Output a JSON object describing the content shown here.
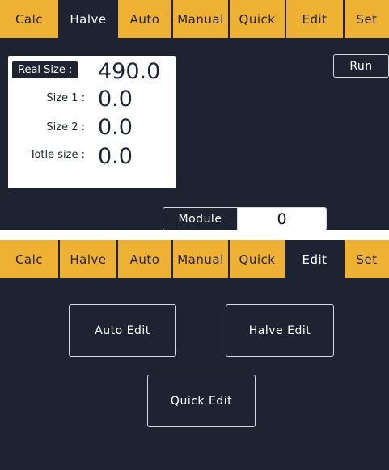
{
  "screen1": {
    "tabs": [
      "Calc",
      "Halve",
      "Auto",
      "Manual",
      "Quick",
      "Edit",
      "Set"
    ],
    "active_tab": "Halve",
    "fields": [
      {
        "label": "Real Size :",
        "value": "490.0"
      },
      {
        "label": "Size 1 :",
        "value": "0.0"
      },
      {
        "label": "Size 2 :",
        "value": "0.0"
      },
      {
        "label": "Totle size :",
        "value": "0.0"
      }
    ],
    "run_label": "Run",
    "module_label": "Module",
    "module_value": "0"
  },
  "screen2": {
    "tabs": [
      "Calc",
      "Halve",
      "Auto",
      "Manual",
      "Quick",
      "Edit",
      "Set"
    ],
    "active_tab": "Edit",
    "auto_edit_label": "Auto Edit",
    "halve_edit_label": "Halve Edit",
    "quick_edit_label": "Quick Edit"
  },
  "colors": {
    "tab_bar": "#efb134",
    "background": "#1e2332",
    "text_light": "#ffffff",
    "panel_white": "#ffffff"
  }
}
